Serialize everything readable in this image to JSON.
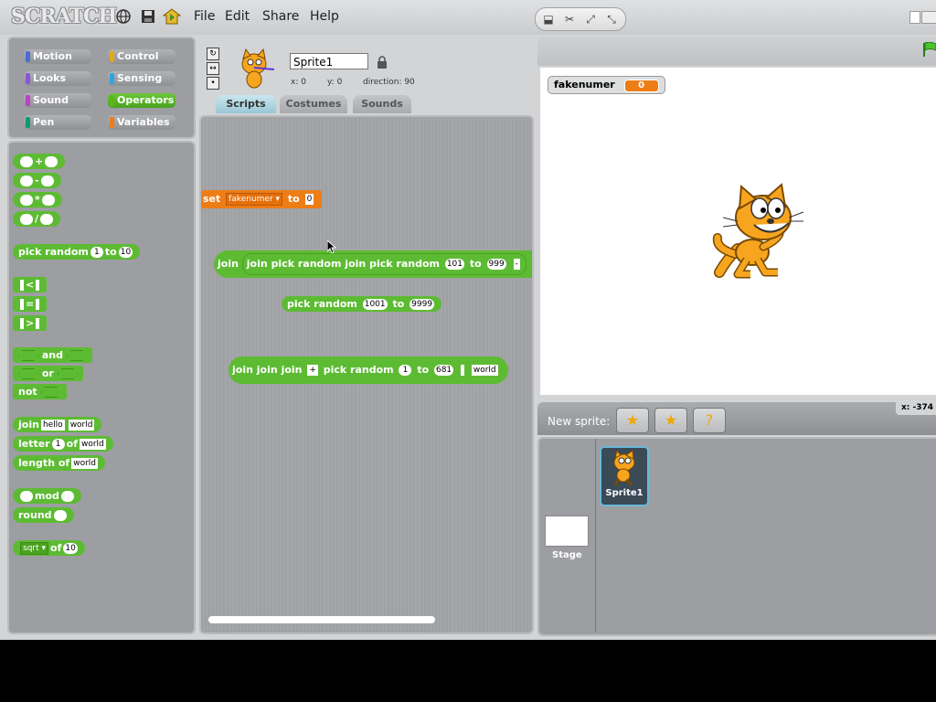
{
  "app": {
    "logo": "SCRATCH"
  },
  "menu": {
    "file": "File",
    "edit": "Edit",
    "share": "Share",
    "help": "Help"
  },
  "top_icons": [
    "globe-icon",
    "save-icon",
    "share-icon"
  ],
  "categories": [
    {
      "label": "Motion",
      "color": "#4a6cd4"
    },
    {
      "label": "Control",
      "color": "#e1a91a"
    },
    {
      "label": "Looks",
      "color": "#8a55d7"
    },
    {
      "label": "Sensing",
      "color": "#2ca5e2"
    },
    {
      "label": "Sound",
      "color": "#bb42c3"
    },
    {
      "label": "Operators",
      "color": "#5cb712"
    },
    {
      "label": "Pen",
      "color": "#0e9a6c"
    },
    {
      "label": "Variables",
      "color": "#ee7d16"
    }
  ],
  "palette": {
    "add": "+",
    "sub": "-",
    "mul": "*",
    "div": "/",
    "pick_random": "pick random",
    "to": "to",
    "pick_from": "1",
    "pick_to": "10",
    "lt": "<",
    "eq": "=",
    "gt": ">",
    "and": "and",
    "or": "or",
    "not": "not",
    "join": "join",
    "join_a": "hello",
    "join_b": "world",
    "letter": "letter",
    "letter_n": "1",
    "of": "of",
    "letter_word": "world",
    "length_of": "length of",
    "length_word": "world",
    "mod": "mod",
    "round": "round",
    "func": "sqrt",
    "func_val": "10"
  },
  "sprite": {
    "name": "Sprite1",
    "x": "x: 0",
    "y": "y: 0",
    "direction": "direction: 90"
  },
  "tabs": {
    "scripts": "Scripts",
    "costumes": "Costumes",
    "sounds": "Sounds"
  },
  "scripts": {
    "set": "set",
    "set_var": "fakenumer",
    "set_to": "to",
    "set_val": "0",
    "s2_join": "join",
    "s2_pick": "pick random",
    "s2_from": "101",
    "s2_to_label": "to",
    "s2_to": "999",
    "s2_minus": "-",
    "s3_pick": "pick random",
    "s3_from": "1001",
    "s3_to_label": "to",
    "s3_to": "9999",
    "s4_join": "join",
    "s4_plus": "+",
    "s4_pick": "pick random",
    "s4_from": "1",
    "s4_to_label": "to",
    "s4_to": "681",
    "s4_world": "world"
  },
  "stage": {
    "var_name": "fakenumer",
    "var_value": "0",
    "mouse_x": "x: -374"
  },
  "sprite_list": {
    "new_sprite": "New sprite:",
    "sprite1": "Sprite1",
    "stage": "Stage"
  }
}
